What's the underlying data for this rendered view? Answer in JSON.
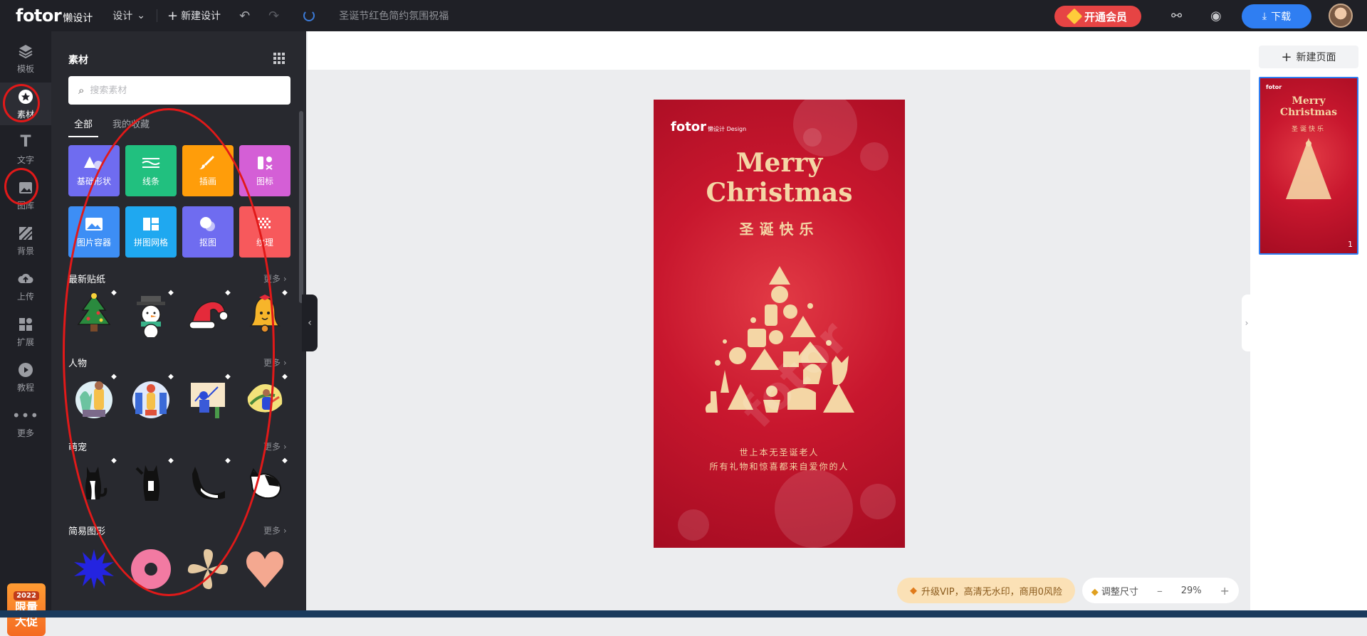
{
  "topbar": {
    "logo": "fotor",
    "logo_sub": "懒设计",
    "menu_design": "设计",
    "new_design": "新建设计",
    "doc_title": "圣诞节红色简约氛围祝福",
    "vip_label": "开通会员",
    "download_label": "下载"
  },
  "leftnav": {
    "items": [
      {
        "label": "模板",
        "icon": "layers-icon"
      },
      {
        "label": "素材",
        "icon": "star-icon"
      },
      {
        "label": "文字",
        "icon": "text-icon"
      },
      {
        "label": "图库",
        "icon": "image-icon"
      },
      {
        "label": "背景",
        "icon": "background-icon"
      },
      {
        "label": "上传",
        "icon": "upload-icon"
      },
      {
        "label": "扩展",
        "icon": "extension-icon"
      },
      {
        "label": "教程",
        "icon": "play-icon"
      },
      {
        "label": "更多",
        "icon": "more-icon"
      }
    ],
    "promo_year": "2022",
    "promo_line1": "限量",
    "promo_line2": "大促"
  },
  "panel": {
    "title": "素材",
    "search_placeholder": "搜索素材",
    "tabs": [
      "全部",
      "我的收藏"
    ],
    "tiles": [
      {
        "label": "基础形状",
        "color": "#6f6cf0"
      },
      {
        "label": "线条",
        "color": "#21c07f"
      },
      {
        "label": "插画",
        "color": "#ff9d0a"
      },
      {
        "label": "图标",
        "color": "#d45fd6"
      },
      {
        "label": "图片容器",
        "color": "#3d8ef5"
      },
      {
        "label": "拼图网格",
        "color": "#1fa8f0"
      },
      {
        "label": "抠图",
        "color": "#6f6cf0"
      },
      {
        "label": "纹理",
        "color": "#f7595c"
      }
    ],
    "sections": [
      {
        "title": "最新贴纸",
        "more": "更多"
      },
      {
        "title": "人物",
        "more": "更多"
      },
      {
        "title": "萌宠",
        "more": "更多"
      },
      {
        "title": "简易图形",
        "more": "更多"
      }
    ]
  },
  "poster": {
    "logo": "fotor",
    "logo_sub": "懒设计 Design",
    "title_line1": "Merry",
    "title_line2": "Christmas",
    "subtitle": "圣诞快乐",
    "line1": "世上本无圣诞老人",
    "line2": "所有礼物和惊喜都来自爱你的人"
  },
  "rightpanel": {
    "new_page": "新建页面",
    "page_number": "1"
  },
  "bottom": {
    "upgrade": "升级VIP，高清无水印，商用0风险",
    "resize": "调整尺寸",
    "zoom": "29%"
  }
}
